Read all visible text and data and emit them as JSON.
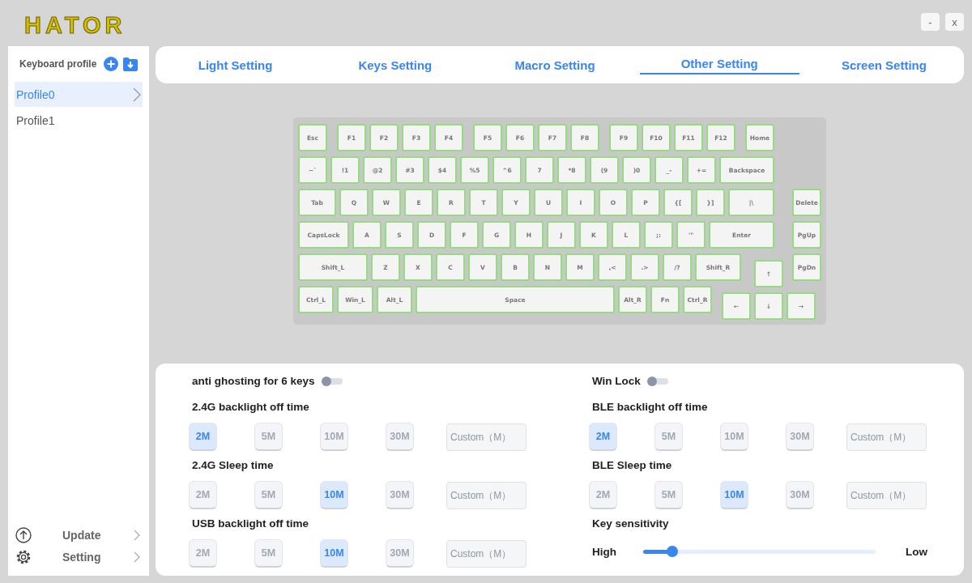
{
  "logo": "HATOR",
  "window_controls": [
    "-",
    "x"
  ],
  "sidebar": {
    "title": "Keyboard profile",
    "profiles": [
      {
        "label": "Profile0",
        "selected": true
      },
      {
        "label": "Profile1",
        "selected": false
      }
    ],
    "footer_items": [
      {
        "kind": "update",
        "label": "Update"
      },
      {
        "kind": "setting",
        "label": "Setting"
      }
    ]
  },
  "tabs": [
    {
      "label": "Light Setting",
      "selected": false
    },
    {
      "label": "Keys Setting",
      "selected": false
    },
    {
      "label": "Macro Setting",
      "selected": false
    },
    {
      "label": "Other Setting",
      "selected": true
    },
    {
      "label": "Screen Setting",
      "selected": false
    }
  ],
  "keyboard": {
    "rows": [
      {
        "keys": [
          "Esc",
          "F1",
          "F2",
          "F3",
          "F4",
          "F5",
          "F6",
          "F7",
          "F8",
          "F9",
          "F10",
          "F11",
          "F12",
          "Home"
        ]
      },
      {
        "keys": [
          "~`",
          "!1",
          "@2",
          "#3",
          "$4",
          "%5",
          "^6",
          "7",
          "*8",
          "(9",
          ")0",
          "_-",
          "+=",
          "Backspace"
        ]
      },
      {
        "keys": [
          "Tab",
          "Q",
          "W",
          "E",
          "R",
          "T",
          "Y",
          "U",
          "I",
          "O",
          "P",
          "{[",
          "}]",
          "|\\",
          "Delete"
        ]
      },
      {
        "keys": [
          "CapsLock",
          "A",
          "S",
          "D",
          "F",
          "G",
          "H",
          "J",
          "K",
          "L",
          ";:",
          "'\"",
          "Enter",
          "PgUp"
        ]
      },
      {
        "keys": [
          "Shift_L",
          "Z",
          "X",
          "C",
          "V",
          "B",
          "N",
          "M",
          ",<",
          ".>",
          "/?",
          "Shift_R",
          "↑",
          "PgDn"
        ]
      },
      {
        "keys": [
          "Ctrl_L",
          "Win_L",
          "Alt_L",
          "Space",
          "Alt_R",
          "Fn",
          "Ctrl_R",
          "←",
          "↓",
          "→"
        ]
      }
    ]
  },
  "settings": {
    "left": [
      {
        "kind": "toggle",
        "label": "anti ghosting for 6 keys",
        "on": false
      },
      {
        "kind": "options",
        "title": "2.4G backlight off time",
        "options": [
          {
            "label": "2M",
            "selected": true
          },
          {
            "label": "5M",
            "selected": false
          },
          {
            "label": "10M",
            "selected": false
          },
          {
            "label": "30M",
            "selected": false
          }
        ],
        "placeholder": "Custom（M）"
      },
      {
        "kind": "options",
        "title": "2.4G Sleep time",
        "options": [
          {
            "label": "2M",
            "selected": false
          },
          {
            "label": "5M",
            "selected": false
          },
          {
            "label": "10M",
            "selected": true
          },
          {
            "label": "30M",
            "selected": false
          }
        ],
        "placeholder": "Custom（M）"
      },
      {
        "kind": "options",
        "title": "USB backlight off time",
        "options": [
          {
            "label": "2M",
            "selected": false
          },
          {
            "label": "5M",
            "selected": false
          },
          {
            "label": "10M",
            "selected": true
          },
          {
            "label": "30M",
            "selected": false
          }
        ],
        "placeholder": "Custom（M）"
      }
    ],
    "right": [
      {
        "kind": "toggle",
        "label": "Win Lock",
        "on": false
      },
      {
        "kind": "options",
        "title": "BLE backlight off time",
        "options": [
          {
            "label": "2M",
            "selected": true
          },
          {
            "label": "5M",
            "selected": false
          },
          {
            "label": "10M",
            "selected": false
          },
          {
            "label": "30M",
            "selected": false
          }
        ],
        "placeholder": "Custom（M）"
      },
      {
        "kind": "options",
        "title": "BLE Sleep time",
        "options": [
          {
            "label": "2M",
            "selected": false
          },
          {
            "label": "5M",
            "selected": false
          },
          {
            "label": "10M",
            "selected": true
          },
          {
            "label": "30M",
            "selected": false
          }
        ],
        "placeholder": "Custom（M）"
      },
      {
        "kind": "slider",
        "title": "Key sensitivity",
        "start_label": "High",
        "end_label": "Low",
        "level": 0.125
      }
    ]
  }
}
